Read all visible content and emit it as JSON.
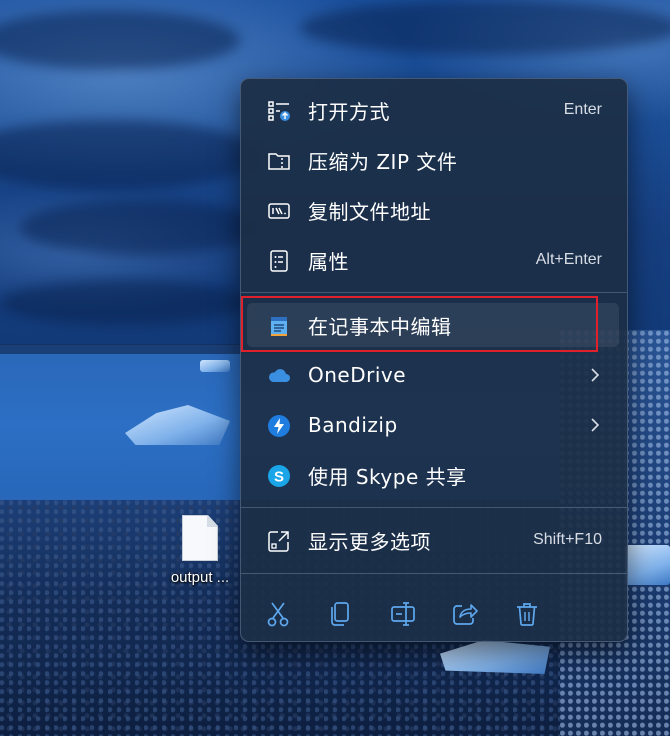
{
  "desktop": {
    "file_label": "output ..."
  },
  "context_menu": {
    "items": [
      {
        "label": "打开方式",
        "shortcut": "Enter",
        "icon": "open-with-icon"
      },
      {
        "label": "压缩为 ZIP 文件",
        "shortcut": "",
        "icon": "zip-folder-icon"
      },
      {
        "label": "复制文件地址",
        "shortcut": "",
        "icon": "copy-path-icon"
      },
      {
        "label": "属性",
        "shortcut": "Alt+Enter",
        "icon": "properties-icon"
      },
      {
        "label": "在记事本中编辑",
        "shortcut": "",
        "icon": "notepad-icon",
        "highlighted": true
      },
      {
        "label": "OneDrive",
        "shortcut": "",
        "icon": "onedrive-icon",
        "submenu": true
      },
      {
        "label": "Bandizip",
        "shortcut": "",
        "icon": "bandizip-icon",
        "submenu": true
      },
      {
        "label": "使用 Skype 共享",
        "shortcut": "",
        "icon": "skype-icon"
      },
      {
        "label": "显示更多选项",
        "shortcut": "Shift+F10",
        "icon": "show-more-options-icon"
      }
    ],
    "toolbar": [
      {
        "name": "cut",
        "icon": "scissors-icon"
      },
      {
        "name": "copy",
        "icon": "copy-icon"
      },
      {
        "name": "rename",
        "icon": "rename-icon"
      },
      {
        "name": "share",
        "icon": "share-icon"
      },
      {
        "name": "delete",
        "icon": "trash-icon"
      }
    ]
  },
  "colors": {
    "menu_bg": "#1c2e46",
    "highlight_border": "#e0202a",
    "onedrive_blue": "#3a8fe0",
    "bandizip_blue": "#1f7de0",
    "skype_blue": "#1aa5e8",
    "toolbar_icon": "#5ea8ee"
  }
}
